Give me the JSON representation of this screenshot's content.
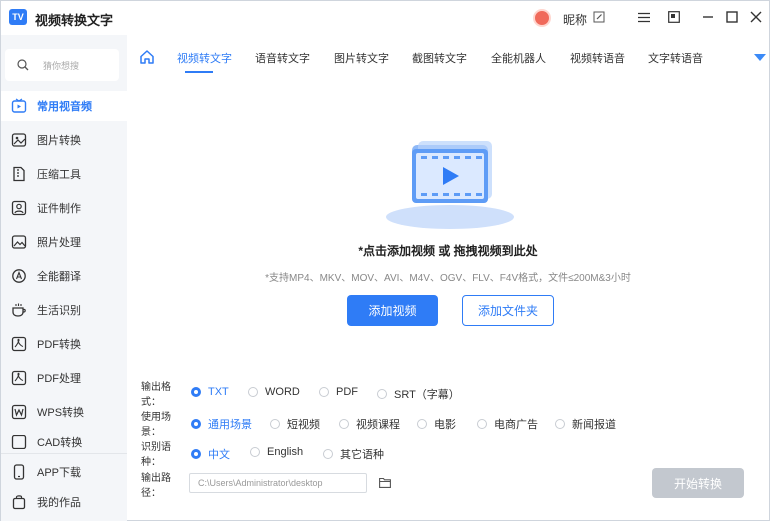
{
  "app": {
    "logo_text": "TV",
    "title": "视频转换文字"
  },
  "user": {
    "nickname": "昵称"
  },
  "window_controls": {
    "menu_icon": "menu-icon",
    "skin_icon": "skin-icon",
    "minimize": "—",
    "maximize": "□",
    "close": "✕"
  },
  "sidebar": {
    "search_placeholder": "猜你想搜",
    "items": [
      {
        "label": "常用视音频",
        "icon": "video-tv-icon",
        "active": true
      },
      {
        "label": "图片转换",
        "icon": "image-convert-icon"
      },
      {
        "label": "压缩工具",
        "icon": "compress-icon"
      },
      {
        "label": "证件制作",
        "icon": "id-photo-icon"
      },
      {
        "label": "照片处理",
        "icon": "photo-icon"
      },
      {
        "label": "全能翻译",
        "icon": "translate-icon"
      },
      {
        "label": "生活识别",
        "icon": "cup-icon"
      },
      {
        "label": "PDF转换",
        "icon": "pdf-convert-icon"
      },
      {
        "label": "PDF处理",
        "icon": "pdf-process-icon"
      },
      {
        "label": "WPS转换",
        "icon": "wps-icon"
      },
      {
        "label": "CAD转换",
        "icon": "cad-icon"
      }
    ],
    "bottom": [
      {
        "label": "APP下载",
        "icon": "phone-icon"
      },
      {
        "label": "我的作品",
        "icon": "bag-icon"
      }
    ]
  },
  "tabs": [
    "视频转文字",
    "语音转文字",
    "图片转文字",
    "截图转文字",
    "全能机器人",
    "视频转语音",
    "文字转语音"
  ],
  "active_tab": "视频转文字",
  "drop": {
    "title": "*点击添加视频 或 拖拽视频到此处",
    "hint": "*支持MP4、MKV、MOV、AVI、M4V、OGV、FLV、F4V格式，文件≤200M&3小时",
    "add_video": "添加视频",
    "add_folder": "添加文件夹"
  },
  "options": {
    "format": {
      "label": "输出格式：",
      "choices": [
        "TXT",
        "WORD",
        "PDF",
        "SRT（字幕）"
      ],
      "selected": "TXT"
    },
    "scene": {
      "label": "使用场景：",
      "choices": [
        "通用场景",
        "短视频",
        "视频课程",
        "电影",
        "电商广告",
        "新闻报道"
      ],
      "selected": "通用场景"
    },
    "language": {
      "label": "识别语种：",
      "choices": [
        "中文",
        "English",
        "其它语种"
      ],
      "selected": "中文"
    }
  },
  "output": {
    "label": "输出路径：",
    "path": "C:\\Users\\Administrator\\desktop",
    "start": "开始转换"
  },
  "colors": {
    "accent": "#2f7cf6",
    "sidebar_bg": "#f4f6f9",
    "disabled": "#c3c8cf"
  }
}
